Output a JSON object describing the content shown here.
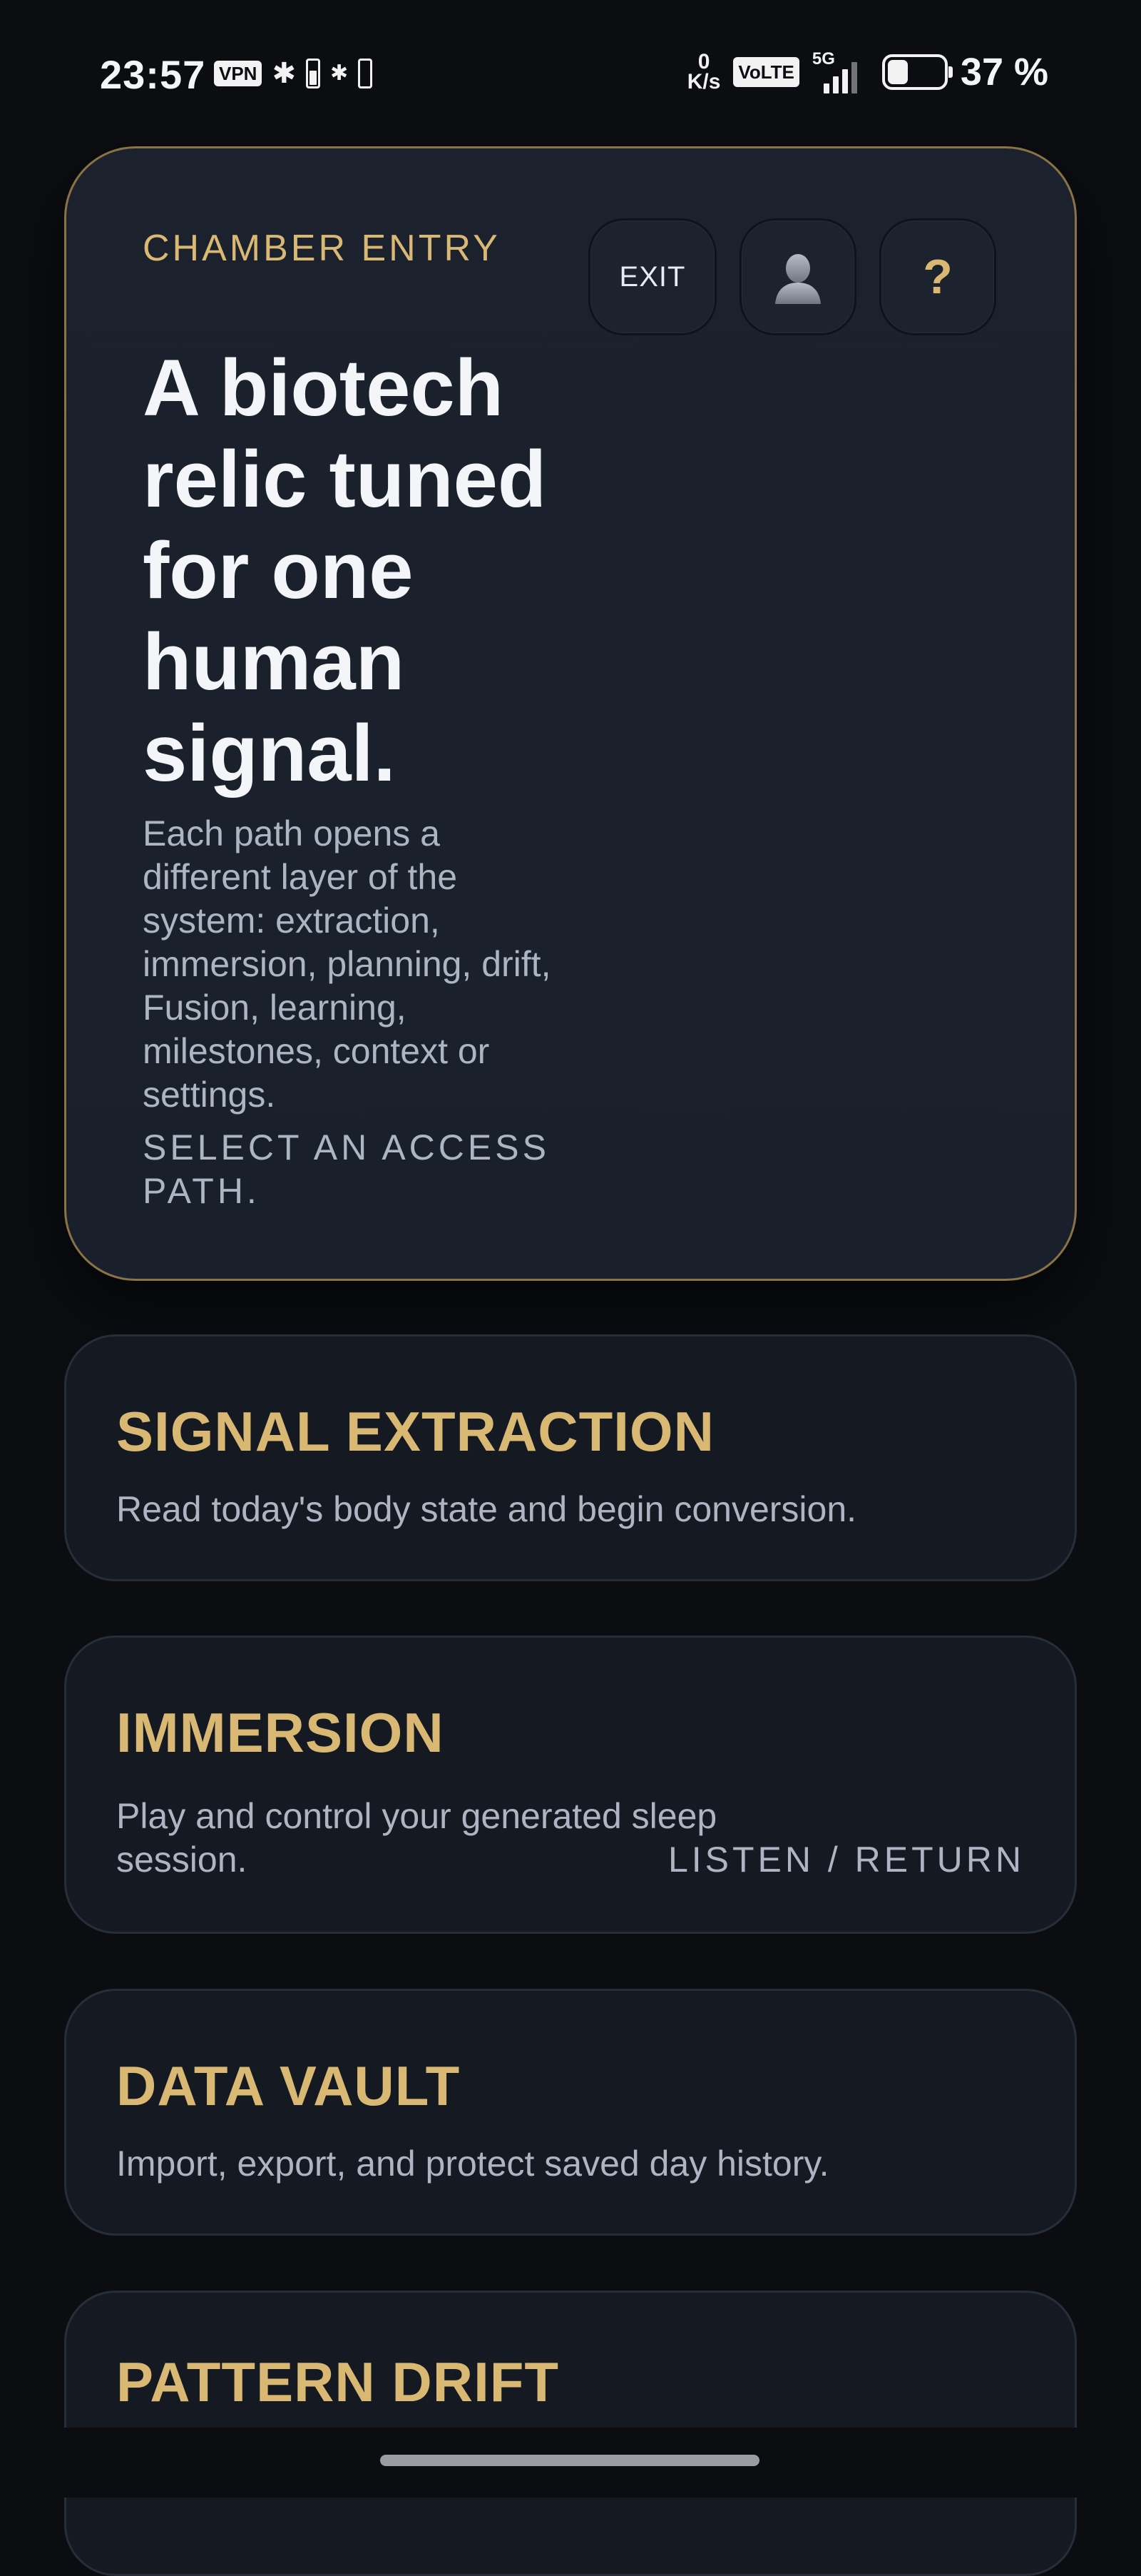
{
  "status_bar": {
    "time": "23:57",
    "vpn": "VPN",
    "net_speed_value": "0",
    "net_speed_unit": "K/s",
    "volte": "VoLTE",
    "network": "5G",
    "signal_level": 0.75,
    "battery_level": 0.37,
    "battery_text": "37 %"
  },
  "hero": {
    "eyebrow": "CHAMBER ENTRY",
    "exit_label": "EXIT",
    "help_label": "?",
    "user_icon": "user-silhouette-icon",
    "title": "A biotech relic tuned for one human signal.",
    "body": "Each path opens a different layer of the system: extraction, immersion, planning, drift, Fusion, learning, milestones, context or settings.",
    "prompt": "SELECT AN ACCESS PATH."
  },
  "paths": [
    {
      "title": "SIGNAL EXTRACTION",
      "description": "Read today's body state and begin conversion."
    },
    {
      "title": "IMMERSION",
      "description": "Play and control your generated sleep session.",
      "tag": "LISTEN / RETURN"
    },
    {
      "title": "DATA VAULT",
      "description": "Import, export, and protect saved day history."
    },
    {
      "title": "PATTERN DRIFT"
    }
  ],
  "colors": {
    "background": "#0b0d11",
    "card": "#141922",
    "hero_card": "#1b212d",
    "accent_gold": "#d8b872",
    "hero_border": "#8a7445",
    "text_muted": "#aeb5c2"
  }
}
